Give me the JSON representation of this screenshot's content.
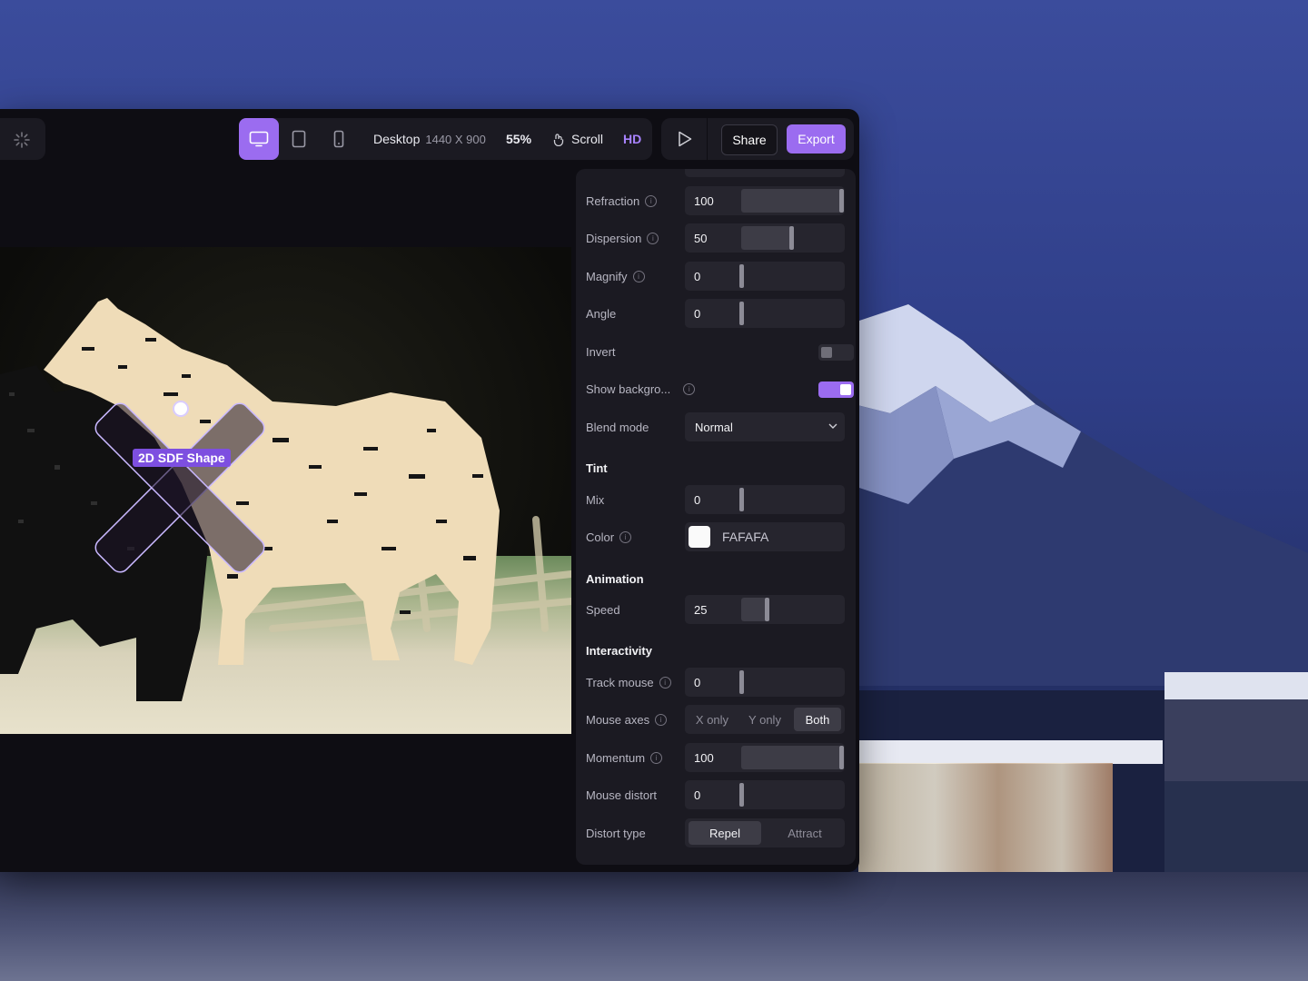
{
  "toolbar": {
    "device_label": "Desktop",
    "device_size": "1440 X 900",
    "zoom": "55%",
    "scroll_label": "Scroll",
    "quality_label": "HD",
    "share_label": "Share",
    "export_label": "Export",
    "active_device": "desktop"
  },
  "canvas": {
    "shape_label": "2D SDF Shape"
  },
  "panel": {
    "refraction": {
      "label": "Refraction",
      "value": "100",
      "fraction": 1.0
    },
    "dispersion": {
      "label": "Dispersion",
      "value": "50",
      "fraction": 0.5
    },
    "magnify": {
      "label": "Magnify",
      "value": "0",
      "fraction": 0.0
    },
    "angle": {
      "label": "Angle",
      "value": "0",
      "fraction": 0.0
    },
    "invert": {
      "label": "Invert",
      "on": false
    },
    "show_background": {
      "label": "Show backgro...",
      "on": true
    },
    "blend_mode": {
      "label": "Blend mode",
      "value": "Normal"
    },
    "tint_title": "Tint",
    "mix": {
      "label": "Mix",
      "value": "0",
      "fraction": 0.0
    },
    "color": {
      "label": "Color",
      "hex": "FAFAFA",
      "swatch": "#fafafa"
    },
    "animation_title": "Animation",
    "speed": {
      "label": "Speed",
      "value": "25",
      "fraction": 0.25
    },
    "interactivity_title": "Interactivity",
    "track_mouse": {
      "label": "Track mouse",
      "value": "0",
      "fraction": 0.0
    },
    "mouse_axes": {
      "label": "Mouse axes",
      "options": [
        "X only",
        "Y only",
        "Both"
      ],
      "selected": "Both"
    },
    "momentum": {
      "label": "Momentum",
      "value": "100",
      "fraction": 1.0
    },
    "mouse_distort": {
      "label": "Mouse distort",
      "value": "0",
      "fraction": 0.0
    },
    "distort_type": {
      "label": "Distort type",
      "options": [
        "Repel",
        "Attract"
      ],
      "selected": "Repel"
    }
  },
  "colors": {
    "accent": "#9b6cf0",
    "panel_bg": "#1b1a22",
    "window_bg": "#0e0d13"
  },
  "icons": [
    "sparkle-icon",
    "desktop-icon",
    "tablet-icon",
    "mobile-icon",
    "scroll-icon",
    "play-icon",
    "info-icon",
    "chevron-down-icon"
  ]
}
